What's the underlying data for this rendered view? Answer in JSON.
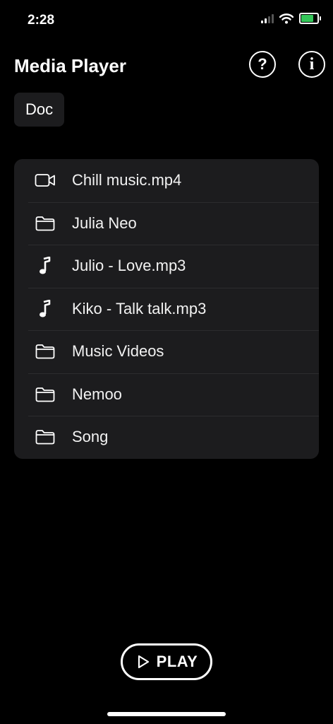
{
  "status": {
    "time": "2:28",
    "battery_level": 0.85,
    "battery_color": "#34c759"
  },
  "header": {
    "title": "Media Player",
    "help_icon": "question-circle-icon",
    "info_icon": "info-circle-icon"
  },
  "filter": {
    "chip_label": "Doc"
  },
  "files": [
    {
      "label": "Chill music.mp4",
      "icon": "video-camera-icon"
    },
    {
      "label": "Julia Neo",
      "icon": "folder-icon"
    },
    {
      "label": "Julio - Love.mp3",
      "icon": "music-note-icon"
    },
    {
      "label": "Kiko - Talk talk.mp3",
      "icon": "music-note-icon"
    },
    {
      "label": "Music Videos",
      "icon": "folder-icon"
    },
    {
      "label": "Nemoo",
      "icon": "folder-icon"
    },
    {
      "label": "Song",
      "icon": "folder-icon"
    }
  ],
  "player": {
    "play_label": "PLAY",
    "play_icon": "play-icon"
  }
}
